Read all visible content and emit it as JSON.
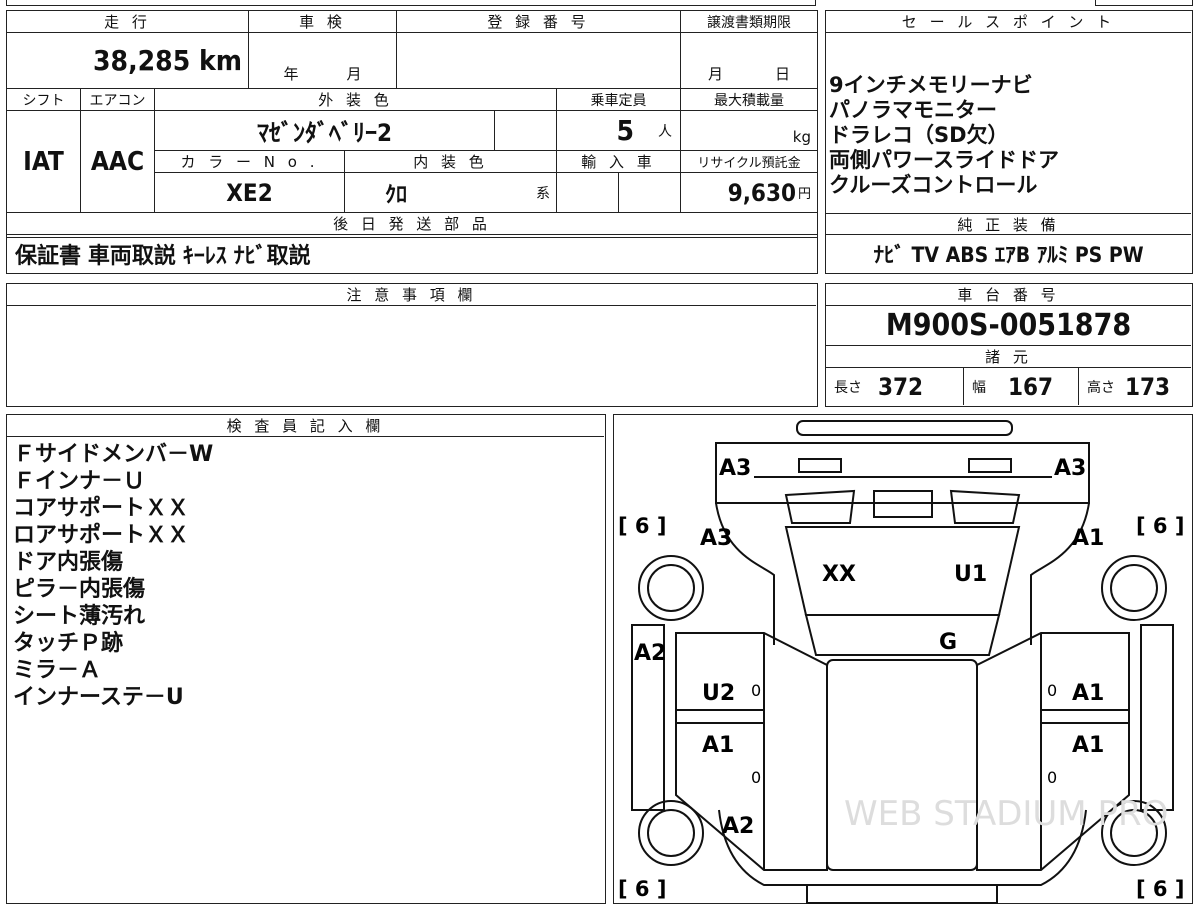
{
  "top_strip": {
    "left": "",
    "mid": "",
    "right": ""
  },
  "vehicle_info": {
    "mileage": {
      "label": "走 行",
      "value": "38,285 km"
    },
    "inspection": {
      "label": "車 検",
      "year_unit": "年",
      "month_unit": "月"
    },
    "registration": {
      "label": "登 録 番 号",
      "value": ""
    },
    "transfer_deadline": {
      "label": "譲渡書類期限",
      "month_unit": "月",
      "day_unit": "日"
    },
    "shift": {
      "label": "シフト",
      "value": "IAT"
    },
    "aircon": {
      "label": "エアコン",
      "value": "AAC"
    },
    "exterior_color": {
      "label": "外 装 色",
      "value": "ﾏｾﾞﾝﾀﾞﾍﾞﾘｰ2"
    },
    "capacity": {
      "label": "乗車定員",
      "value": "5",
      "unit": "人"
    },
    "max_load": {
      "label": "最大積載量",
      "unit": "kg"
    },
    "color_no": {
      "label": "カ ラ ー N o .",
      "value": "XE2"
    },
    "interior_color": {
      "label": "内 装 色",
      "value": "ｸﾛ",
      "suffix": "系"
    },
    "import": {
      "label": "輸 入 車"
    },
    "recycle_fee": {
      "label": "リサイクル預託金",
      "value": "9,630",
      "unit": "円"
    }
  },
  "sales_points": {
    "title": "セ ー ル ス ポ イ ン ト",
    "items": [
      "9インチメモリーナビ",
      "パノラマモニター",
      "ドラレコ（SD欠）",
      "両側パワースライドドア",
      "クルーズコントロール"
    ]
  },
  "later_shipping": {
    "title": "後 日 発 送 部 品",
    "value": "保証書 車両取説 ｷｰﾚｽ ﾅﾋﾞ取説"
  },
  "standard_equipment": {
    "title": "純 正 装 備",
    "value": "ﾅﾋﾞ TV ABS ｴｱB ｱﾙﾐ PS PW"
  },
  "notes": {
    "title": "注 意 事 項 欄",
    "value": ""
  },
  "chassis": {
    "title": "車 台 番 号",
    "value": "M900S-0051878"
  },
  "specs": {
    "title": "諸 元",
    "length_label": "長さ",
    "length": "372",
    "width_label": "幅",
    "width": "167",
    "height_label": "高さ",
    "height": "173"
  },
  "inspector": {
    "title": "検 査 員 記 入 欄",
    "lines": [
      "Ｆサイドメンバ－W",
      "Ｆインナ－Ｕ",
      "コアサポートＸＸ",
      "ロアサポートＸＸ",
      "ドア内張傷",
      "ピラ－内張傷",
      "シート薄汚れ",
      "タッチＰ跡",
      "ミラ－Ａ",
      "インナーステ－U"
    ]
  },
  "diagram": {
    "marks": {
      "a3_top_left": "A3",
      "a3_top_right": "A3",
      "tire_fl": "[ 6 ]",
      "tire_fr": "[ 6 ]",
      "a3_left": "A3",
      "a1_right_top": "A1",
      "xx": "XX",
      "u1": "U1",
      "g": "G",
      "a2_left": "A2",
      "u2": "U2",
      "a1_right_mid": "A1",
      "a1_left": "A1",
      "a1_right_low": "A1",
      "a2_low": "A2",
      "zero_1": "0",
      "zero_2": "0",
      "zero_3": "0",
      "zero_4": "0",
      "tire_rl": "[ 6 ]",
      "tire_rr": "[ 6 ]"
    },
    "watermark": "WEB STADIUM PRO"
  }
}
